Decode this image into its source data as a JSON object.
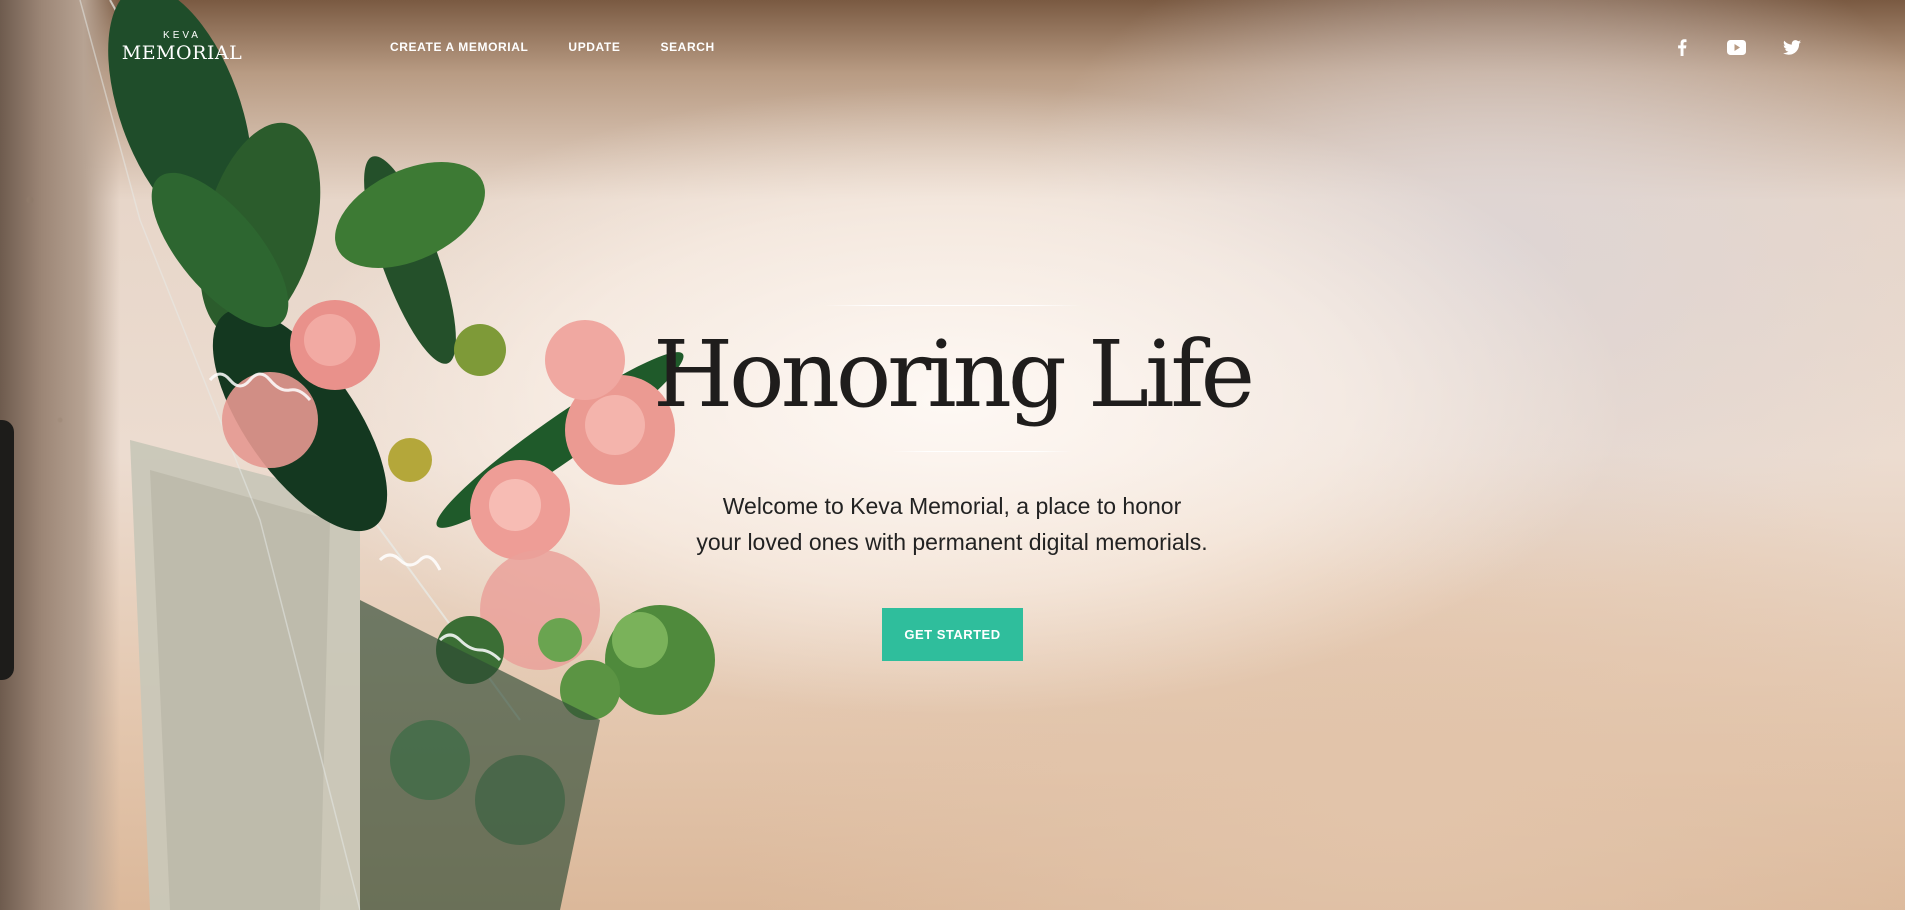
{
  "header": {
    "logo": {
      "top": "KEVA",
      "bottom": "MEMORIAL"
    },
    "nav": [
      {
        "label": "CREATE A MEMORIAL"
      },
      {
        "label": "UPDATE"
      },
      {
        "label": "SEARCH"
      }
    ],
    "social": [
      {
        "icon": "facebook-icon"
      },
      {
        "icon": "youtube-icon"
      },
      {
        "icon": "twitter-icon"
      }
    ]
  },
  "hero": {
    "title": "Honoring Life",
    "subtitle_line1": "Welcome to Keva Memorial, a place to honor",
    "subtitle_line2": "your loved ones with permanent digital memorials.",
    "cta_label": "GET STARTED"
  },
  "colors": {
    "accent": "#2fbe9c",
    "title_text": "#1f1d1c",
    "body_text": "#222222",
    "header_text": "#ffffff"
  }
}
